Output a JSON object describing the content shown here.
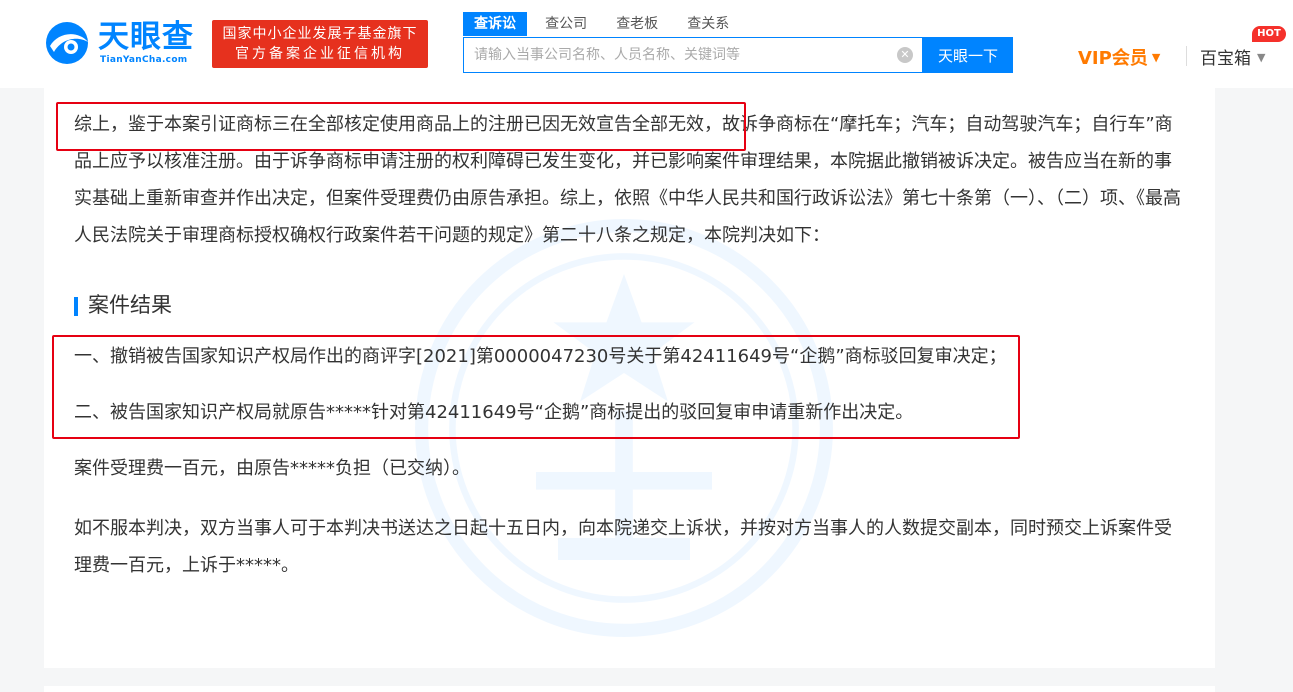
{
  "header": {
    "logo": {
      "name": "天眼查",
      "domain": "TianYanCha.com"
    },
    "slogan": {
      "line1": "国家中小企业发展子基金旗下",
      "line2": "官方备案企业征信机构"
    },
    "search": {
      "tabs": [
        "查诉讼",
        "查公司",
        "查老板",
        "查关系"
      ],
      "active_tab": 0,
      "placeholder": "请输入当事公司名称、人员名称、关键词等",
      "button_label": "天眼一下"
    },
    "vip_label": "VIP会员",
    "baobox_label": "百宝箱",
    "hot_badge": "HOT",
    "colors": {
      "brand": "#0084ff",
      "slogan_bg": "#e6311e",
      "vip": "#ff7a00",
      "hot": "#f5312b"
    }
  },
  "document": {
    "paragraph1": "综上，鉴于本案引证商标三在全部核定使用商品上的注册已因无效宣告全部无效，故诉争商标在“摩托车；汽车；自动驾驶汽车；自行车”商品上应予以核准注册。由于诉争商标申请注册的权利障碍已发生变化，并已影响案件审理结果，本院据此撤销被诉决定。被告应当在新的事实基础上重新审查并作出决定，但案件受理费仍由原告承担。综上，依照《中华人民共和国行政诉讼法》第七十条第（一）、（二）项、《最高人民法院关于审理商标授权确权行政案件若干问题的规定》第二十八条之规定，本院判决如下：",
    "section_title": "案件结果",
    "result1": "一、撤销被告国家知识产权局作出的商评字[2021]第0000047230号关于第42411649号“企鹅”商标驳回复审决定；",
    "result2": "二、被告国家知识产权局就原告*****针对第42411649号“企鹅”商标提出的驳回复审申请重新作出决定。",
    "paragraph3": "案件受理费一百元，由原告*****负担（已交纳）。",
    "paragraph4": "如不服本判决，双方当事人可于本判决书送达之日起十五日内，向本院递交上诉状，并按对方当事人的人数提交副本，同时预交上诉案件受理费一百元，上诉于*****。",
    "highlight_color": "#e60012"
  }
}
